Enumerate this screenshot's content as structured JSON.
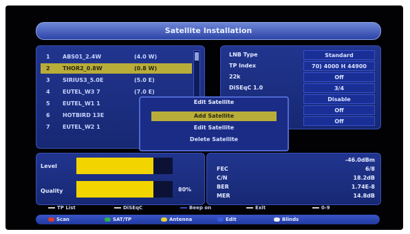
{
  "title": "Satellite Installation",
  "satellites": [
    {
      "num": "1",
      "name": "ABS01_2.4W",
      "pos": "(4.0 W)"
    },
    {
      "num": "2",
      "name": "THOR2_0.8W",
      "pos": "(0.8 W)"
    },
    {
      "num": "3",
      "name": "SIRIUS3_5.0E",
      "pos": "(5.0 E)"
    },
    {
      "num": "4",
      "name": "EUTEL_W3 7",
      "pos": "(7.0 E)"
    },
    {
      "num": "5",
      "name": "EUTEL_W1 1",
      "pos": ""
    },
    {
      "num": "6",
      "name": "HOTBIRD 13E",
      "pos": ""
    },
    {
      "num": "7",
      "name": "EUTEL_W2 1",
      "pos": ""
    }
  ],
  "selected_index": 1,
  "settings": [
    {
      "label": "LNB Type",
      "value": "Standard"
    },
    {
      "label": "TP Index",
      "value": "70) 4000 H 44900"
    },
    {
      "label": "22k",
      "value": "Off"
    },
    {
      "label": "DiSEqC 1.0",
      "value": "3/4"
    },
    {
      "label": "",
      "value": "Disable"
    },
    {
      "label": "",
      "value": "Off"
    },
    {
      "label": "",
      "value": "Off"
    }
  ],
  "levels": {
    "level_label": "Level",
    "quality_label": "Quality",
    "level_value": 0.8,
    "quality_value": 0.8,
    "quality_pct": "80%"
  },
  "quality_stats": [
    {
      "label": "",
      "value": "-46.0dBm"
    },
    {
      "label": "FEC",
      "value": "6/8"
    },
    {
      "label": "C/N",
      "value": "18.2dB"
    },
    {
      "label": "BER",
      "value": "1.74E-8"
    },
    {
      "label": "MER",
      "value": "14.8dB"
    }
  ],
  "popup": {
    "title": "Edit Satellite",
    "items": [
      "Add Satellite",
      "Edit Satellite",
      "Delete Satellite"
    ],
    "selected": 0
  },
  "hints": [
    {
      "label": "TP List",
      "color": "#d0d0d0"
    },
    {
      "label": "DiSEqC",
      "color": "#d0d0d0"
    },
    {
      "label": "Beep on",
      "color": "#3b4fc4"
    },
    {
      "label": "Exit",
      "color": "#d0d0d0"
    },
    {
      "label": "0-9",
      "color": "#d0d0d0"
    }
  ],
  "footer": [
    {
      "label": "Scan",
      "color": "#e03b2a"
    },
    {
      "label": "SAT/TP",
      "color": "#2fb14a"
    },
    {
      "label": "Antenna",
      "color": "#e8d52b"
    },
    {
      "label": "Edit",
      "color": "#3a5be0"
    },
    {
      "label": "Blinds",
      "color": "#f0f0f0"
    }
  ]
}
